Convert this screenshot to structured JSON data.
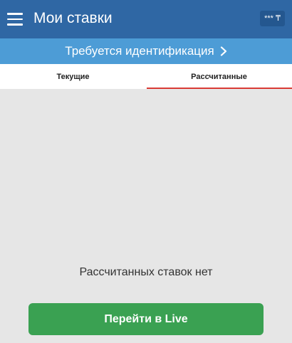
{
  "header": {
    "title": "Мои ставки",
    "balance": "*** ₸",
    "menu_icon": "hamburger-menu-icon"
  },
  "banner": {
    "text": "Требуется идентификация",
    "icon": "chevron-right-icon"
  },
  "tabs": [
    {
      "label": "Текущие",
      "active": false
    },
    {
      "label": "Рассчитанные",
      "active": true
    }
  ],
  "empty_state": {
    "message": "Рассчитанных ставок нет",
    "button_label": "Перейти в Live"
  },
  "colors": {
    "header_bg": "#2f67a4",
    "banner_bg": "#4d9cd6",
    "tab_indicator": "#d93a35",
    "button_bg": "#3aa152",
    "content_bg": "#e6e6e6"
  }
}
